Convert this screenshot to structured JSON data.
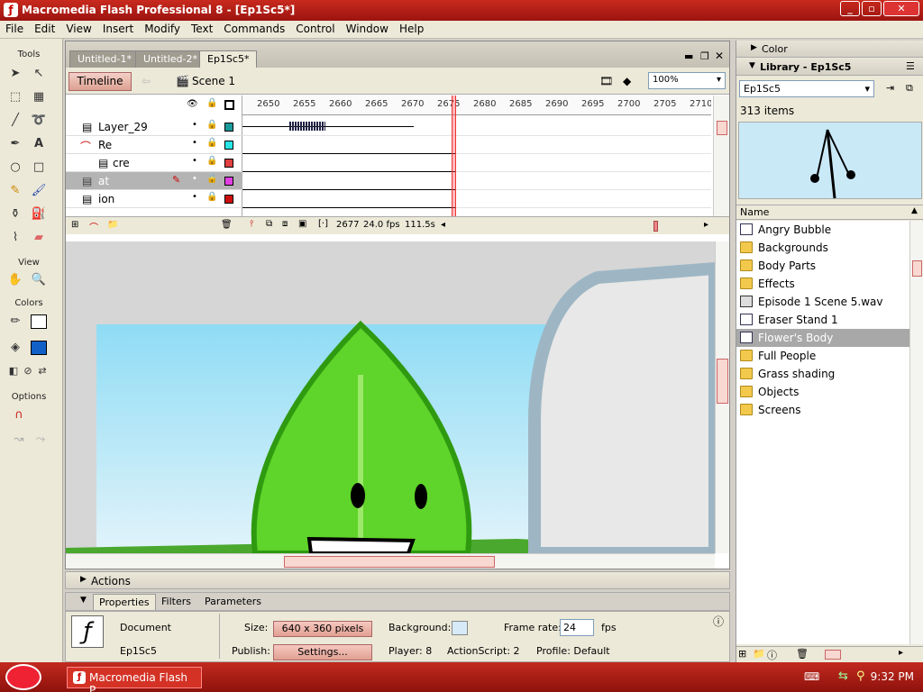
{
  "window": {
    "title": "Macromedia Flash Professional 8 - [Ep1Sc5*]"
  },
  "menu": [
    "File",
    "Edit",
    "View",
    "Insert",
    "Modify",
    "Text",
    "Commands",
    "Control",
    "Window",
    "Help"
  ],
  "tools": {
    "title": "Tools",
    "view_label": "View",
    "colors_label": "Colors",
    "options_label": "Options"
  },
  "doc_tabs": [
    {
      "label": "Untitled-1*"
    },
    {
      "label": "Untitled-2*"
    },
    {
      "label": "Ep1Sc5*"
    }
  ],
  "timeline": {
    "button_label": "Timeline",
    "scene_label": "Scene 1",
    "zoom": "100%",
    "ruler_ticks": [
      "2650",
      "2655",
      "2660",
      "2665",
      "2670",
      "2675",
      "2680",
      "2685",
      "2690",
      "2695",
      "2700",
      "2705",
      "2710"
    ],
    "layers": [
      {
        "name": "Layer_29",
        "color": "#1a9a9a"
      },
      {
        "name": "Re",
        "color": "#29e5e5"
      },
      {
        "name": "cre",
        "color": "#e04040"
      },
      {
        "name": "at",
        "color": "#e040e0"
      },
      {
        "name": "ion",
        "color": "#cc1010"
      }
    ],
    "current_frame": "2677",
    "fps": "24.0 fps",
    "time": "111.5s"
  },
  "actions_label": "Actions",
  "properties": {
    "tabs": [
      "Properties",
      "Filters",
      "Parameters"
    ],
    "type": "Document",
    "name": "Ep1Sc5",
    "size_label": "Size:",
    "size_value": "640 x 360 pixels",
    "publish_label": "Publish:",
    "settings_button": "Settings...",
    "background_label": "Background:",
    "background_color": "#d6eaf8",
    "player_label": "Player: 8",
    "actionscript_label": "ActionScript: 2",
    "framerate_label": "Frame rate:",
    "framerate_value": "24",
    "fps_unit": "fps",
    "profile_label": "Profile: Default"
  },
  "right_panel": {
    "color_header": "Color",
    "library_header": "Library - Ep1Sc5",
    "library_select": "Ep1Sc5",
    "item_count": "313 items",
    "name_column": "Name",
    "items": [
      {
        "label": "Angry Bubble",
        "icon": "symbol-icon"
      },
      {
        "label": "Backgrounds",
        "icon": "folder-icon"
      },
      {
        "label": "Body Parts",
        "icon": "folder-icon"
      },
      {
        "label": "Effects",
        "icon": "folder-icon"
      },
      {
        "label": "Episode 1 Scene 5.wav",
        "icon": "sound-icon"
      },
      {
        "label": "Eraser Stand 1",
        "icon": "symbol-icon"
      },
      {
        "label": "Flower's Body",
        "icon": "symbol-icon"
      },
      {
        "label": "Full People",
        "icon": "folder-icon"
      },
      {
        "label": "Grass shading",
        "icon": "folder-icon"
      },
      {
        "label": "Objects",
        "icon": "folder-icon"
      },
      {
        "label": "Screens",
        "icon": "folder-icon"
      }
    ]
  },
  "taskbar": {
    "item_label": "Macromedia Flash P...",
    "clock": "9:32 PM"
  }
}
